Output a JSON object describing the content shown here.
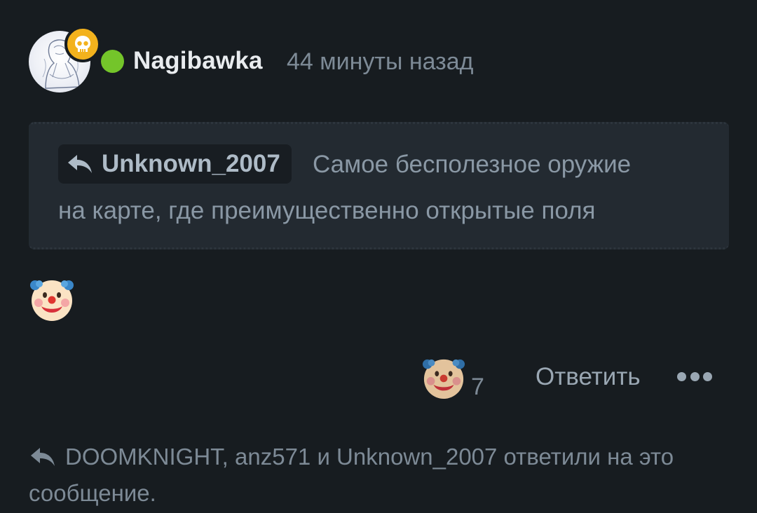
{
  "post": {
    "author": {
      "name": "Nagibawka",
      "status_color": "#74c52a",
      "badge_icon": "skull-icon",
      "badge_color": "#f3b21d"
    },
    "timestamp": "44 минуты назад",
    "quote": {
      "author": "Unknown_2007",
      "line1": "Самое бесполезное оружие",
      "line2": "на карте, где преимущественно открытые поля"
    },
    "body_emoji": "clown-face-icon",
    "reaction": {
      "icon": "clown-face-icon",
      "count": "7"
    },
    "actions": {
      "reply_label": "Ответить",
      "more_icon": "more-dots-icon"
    },
    "replies_note": "DOOMKNIGHT, anz571 и Unknown_2007 ответили на это сообщение."
  },
  "colors": {
    "background": "#171c20",
    "quote_background": "#232a31",
    "primary_text": "#e9ecef",
    "muted_text": "#7d8a96"
  }
}
